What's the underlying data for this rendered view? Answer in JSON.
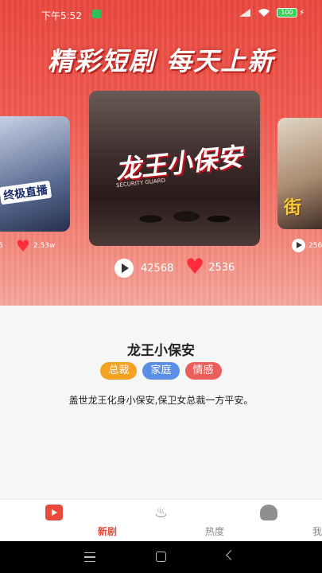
{
  "status_bar": {
    "time": "下午5:52",
    "battery": "100"
  },
  "hero": {
    "headline": "精彩短剧 每天上新",
    "left_poster": {
      "art_text": "终极直播",
      "plays": "5",
      "likes": "2.53w"
    },
    "main_poster": {
      "art_text": "龙王小保安",
      "art_sub": "SECURITY GUARD",
      "plays": "42568",
      "likes": "2536"
    },
    "right_poster": {
      "art_text": "街",
      "plays": "256"
    }
  },
  "detail": {
    "name": "龙王小保安",
    "tags": [
      {
        "label": "总裁",
        "color": "#f4a124"
      },
      {
        "label": "家庭",
        "color": "#5b8ee6"
      },
      {
        "label": "情感",
        "color": "#ec5e5b"
      }
    ],
    "description": "盖世龙王化身小保安,保卫女总裁一方平安。"
  },
  "nav": {
    "items": [
      {
        "label": "新剧",
        "icon": "video-icon",
        "active": true
      },
      {
        "label": "热度",
        "icon": "flame-icon",
        "active": false
      },
      {
        "label": "我的",
        "icon": "user-icon",
        "active": false
      }
    ]
  },
  "colors": {
    "accent": "#e84a3c",
    "hero_top": "#e9473e",
    "heart": "#ff2c3b"
  }
}
